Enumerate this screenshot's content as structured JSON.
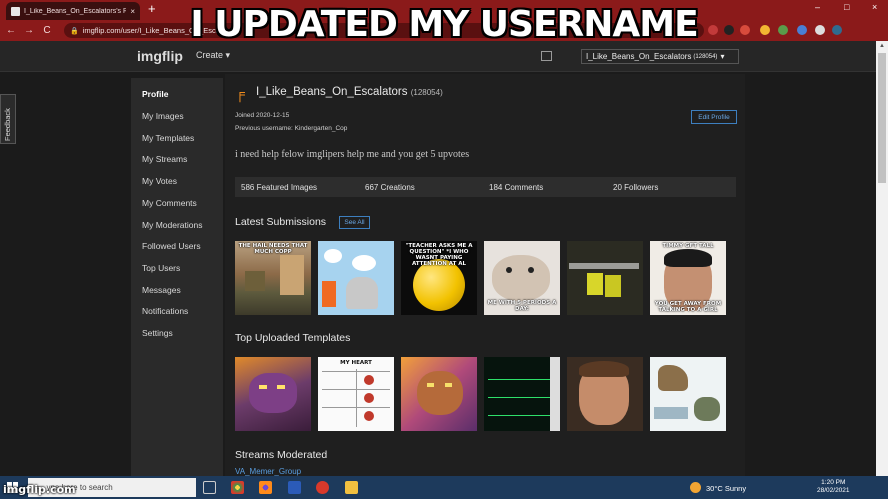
{
  "meme": {
    "caption": "I UPDATED MY USERNAME",
    "watermark": "imgflip.com"
  },
  "browser": {
    "tab_title": "I_Like_Beans_On_Escalators's Pro",
    "url": "imgflip.com/user/I_Like_Beans_On_Escalators",
    "new_tab": "+",
    "tab_close": "×",
    "back": "←",
    "forward": "→",
    "reload": "C",
    "lock": "🔒",
    "minimize": "–",
    "maximize": "□",
    "close": "×"
  },
  "site": {
    "logo": "imgflip",
    "create": "Create ▾",
    "user_button": "I_Like_Beans_On_Escalators",
    "user_points": "(128054)",
    "user_caret": "▾"
  },
  "feedback": "Feedback",
  "sidebar": {
    "items": [
      {
        "label": "Profile"
      },
      {
        "label": "My Images"
      },
      {
        "label": "My Templates"
      },
      {
        "label": "My Streams"
      },
      {
        "label": "My Votes"
      },
      {
        "label": "My Comments"
      },
      {
        "label": "My Moderations"
      },
      {
        "label": "Followed Users"
      },
      {
        "label": "Top Users"
      },
      {
        "label": "Messages"
      },
      {
        "label": "Notifications"
      },
      {
        "label": "Settings"
      }
    ]
  },
  "profile": {
    "username": "I_Like_Beans_On_Escalators",
    "points": "(128054)",
    "joined": "Joined 2020-12-15",
    "previous_username": "Previous username: Kindergarten_Cop",
    "bio": "i need help felow imglipers help me and you get 5 upvotes",
    "edit_label": "Edit Profile"
  },
  "stats": {
    "featured": "586 Featured Images",
    "creations": "667 Creations",
    "comments": "184 Comments",
    "followers": "20 Followers"
  },
  "sections": {
    "latest": "Latest Submissions",
    "see_all": "See All",
    "templates": "Top Uploaded Templates",
    "streams": "Streams Moderated"
  },
  "submissions": [
    {
      "caption_top": "THE HAIL NEEDS THAT MUCH COPP",
      "caption_bottom": "",
      "color": "#7a6650"
    },
    {
      "caption_top": "",
      "caption_bottom": "",
      "color": "#9cc3de"
    },
    {
      "caption_top": "\"TEACHER ASKS ME A QUESTION\" *I WHO WASNT PAYING ATTENTION AT AL",
      "caption_bottom": "",
      "color": "#0a0a0a"
    },
    {
      "caption_top": "",
      "caption_bottom": "ME WITH 5 PERIODS A DAY:",
      "color": "#cfc6bd"
    },
    {
      "caption_top": "",
      "caption_bottom": "",
      "color": "#2b2b1d"
    },
    {
      "caption_top": "TIMMY GFT TALL",
      "caption_bottom": "YOU GET AWAY FROM TALKING TO A GIRL",
      "color": "#b58a6e"
    }
  ],
  "templates": [
    {
      "caption_top": "",
      "color": "#6b3a5d"
    },
    {
      "caption_top": "MY HEART",
      "color": "#f5f5f5"
    },
    {
      "caption_top": "",
      "color": "#7b3e8c"
    },
    {
      "caption_top": "",
      "color": "#0d1a12"
    },
    {
      "caption_top": "",
      "color": "#4a3a2a"
    },
    {
      "caption_top": "",
      "color": "#e6eef0"
    }
  ],
  "stream_link": "VA_Memer_Group",
  "taskbar": {
    "search_placeholder": "ype here to search",
    "weather": "30°C  Sunny",
    "time": "1:20 PM",
    "date": "28/02/2021"
  }
}
